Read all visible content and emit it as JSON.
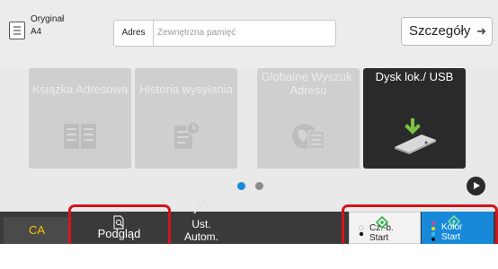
{
  "topbar": {
    "original_label": "Oryginał",
    "original_size": "A4",
    "original_icon": "document-settings-icon",
    "address_label": "Adres",
    "address_placeholder": "Zewnętrzna pamięć",
    "details_label": "Szczegóły",
    "details_icon": "arrow-right-icon"
  },
  "tiles": [
    {
      "label": "Książka Adresowa",
      "icon": "address-book-icon",
      "state": "disabled"
    },
    {
      "label": "Historia wysyłania",
      "icon": "send-history-icon",
      "state": "disabled"
    },
    {
      "label": "Globalne Wyszuk. Adresu",
      "icon": "global-address-search-icon",
      "state": "disabled"
    },
    {
      "label": "Dysk lok./ USB",
      "icon": "local-drive-usb-icon",
      "state": "enabled"
    }
  ],
  "pager": {
    "current": 1,
    "total": 2
  },
  "bottombar": {
    "ca_label": "CA",
    "preview_label": "Podgląd",
    "ust_label_line1": "Ust.",
    "ust_label_line2": "Autom.",
    "bw_line1": "Cz.-b.",
    "bw_line2": "Start",
    "color_line1": "Kolor",
    "color_line2": "Start"
  },
  "colors": {
    "accent_blue": "#1789d8",
    "highlight_red": "#d4141f",
    "ca_yellow": "#f5c400",
    "start_green": "#2db34a"
  }
}
